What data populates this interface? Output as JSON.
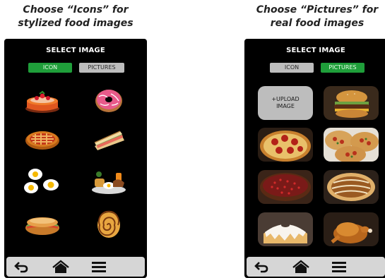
{
  "left_caption": {
    "line1": "Choose “Icons” for",
    "line2": "stylized food images"
  },
  "right_caption": {
    "line1": "Choose “Pictures” for",
    "line2": "real food images"
  },
  "screen_left": {
    "title": "SELECT IMAGE",
    "tabs": {
      "icon": "ICON",
      "pictures": "PICTURES"
    },
    "active_tab": "icon",
    "icons": [
      "cake-icon",
      "donut-icon",
      "pie-icon",
      "sandwich-icon",
      "fried-eggs-icon",
      "breakfast-icon",
      "sub-sandwich-icon",
      "cinnamon-roll-icon"
    ]
  },
  "screen_right": {
    "title": "SELECT IMAGE",
    "tabs": {
      "icon": "ICON",
      "pictures": "PICTURES"
    },
    "active_tab": "pictures",
    "upload": {
      "line1": "+UPLOAD",
      "line2": "IMAGE"
    },
    "pictures": [
      "burger-photo",
      "pepperoni-pizza-photo",
      "pizzas-photo",
      "cherry-pie-photo",
      "pecan-pie-photo",
      "bundt-cake-photo",
      "roast-chicken-photo"
    ]
  },
  "nav": {
    "icons": [
      "back-icon",
      "home-icon",
      "menu-icon"
    ]
  },
  "colors": {
    "screen_bg": "#000000",
    "active_tab": "#1f9e3a",
    "inactive_tab": "#bdbdbd",
    "navbar": "#d6d6d6"
  }
}
